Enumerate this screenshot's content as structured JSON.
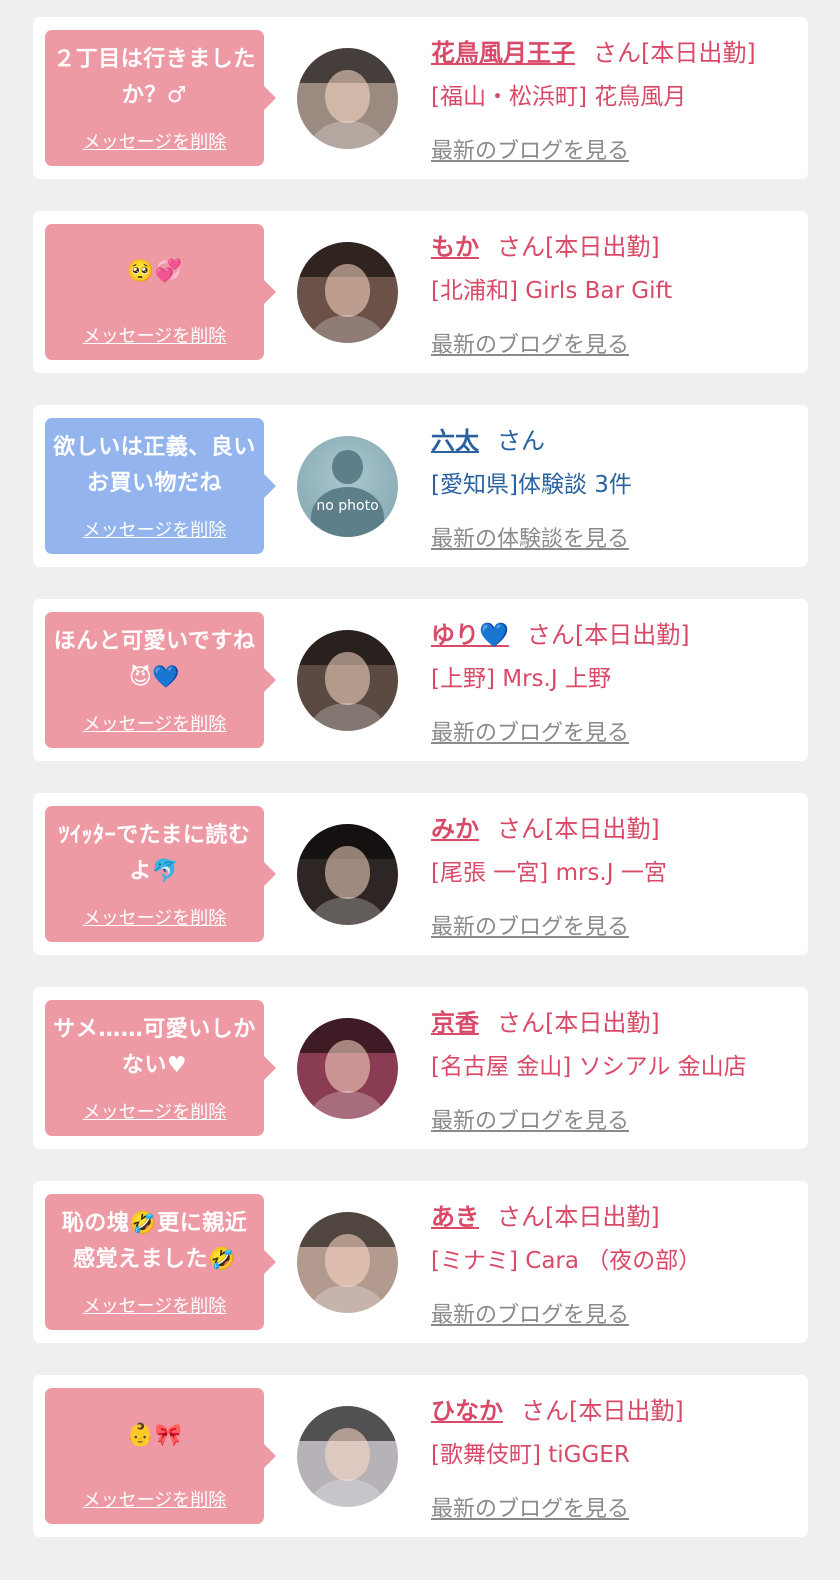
{
  "colors": {
    "background": "#efeff1",
    "card": "#ffffff",
    "bubble_pink": "#ee9aa5",
    "bubble_blue": "#93b4ec",
    "name_pink": "#d84a67",
    "name_blue": "#2a62a0",
    "link_gray": "#8a8a8a"
  },
  "cards": [
    {
      "message": "２丁目は行きましたか？♂",
      "delete_label": "メッセージを削除",
      "avatar": "face-photo",
      "avatar_color": "#9a8a80",
      "name": "花鳥風月王子",
      "suffix": "さん[本日出勤]",
      "shop": "[福山・松浜町] 花鳥風月",
      "link": "最新のブログを見る",
      "gender": "female"
    },
    {
      "message": "🥺💞",
      "delete_label": "メッセージを削除",
      "avatar": "face-photo",
      "avatar_color": "#6b5148",
      "name": "もか",
      "suffix": "さん[本日出勤]",
      "shop": "[北浦和] Girls Bar Gift",
      "link": "最新のブログを見る",
      "gender": "female"
    },
    {
      "message": "欲しいは正義、良いお買い物だね",
      "delete_label": "メッセージを削除",
      "avatar": "no-photo",
      "avatar_color": "#8fb0b9",
      "avatar_text": "no photo",
      "name": "六太",
      "suffix": "さん",
      "shop": "[愛知県]体験談 3件",
      "link": "最新の体験談を見る",
      "gender": "male"
    },
    {
      "message": "ほんと可愛いですね😈💙",
      "delete_label": "メッセージを削除",
      "avatar": "face-photo",
      "avatar_color": "#5a4a42",
      "name": "ゆり💙",
      "suffix": "さん[本日出勤]",
      "shop": "[上野] Mrs.J 上野",
      "link": "最新のブログを見る",
      "gender": "female"
    },
    {
      "message": "ﾂｲｯﾀｰでたまに読むよ🐬",
      "delete_label": "メッセージを削除",
      "avatar": "face-photo",
      "avatar_color": "#2e2624",
      "name": "みか",
      "suffix": "さん[本日出勤]",
      "shop": "[尾張 一宮] mrs.J 一宮",
      "link": "最新のブログを見る",
      "gender": "female"
    },
    {
      "message": "サメ……可愛いしかない♥",
      "delete_label": "メッセージを削除",
      "avatar": "face-photo",
      "avatar_color": "#8a3c52",
      "name": "京香",
      "suffix": "さん[本日出勤]",
      "shop": "[名古屋 金山] ソシアル 金山店",
      "link": "最新のブログを見る",
      "gender": "female"
    },
    {
      "message": "恥の塊🤣更に親近感覚えました🤣",
      "delete_label": "メッセージを削除",
      "avatar": "face-photo",
      "avatar_color": "#b39a8f",
      "name": "あき",
      "suffix": "さん[本日出勤]",
      "shop": "[ミナミ] Cara （夜の部）",
      "link": "最新のブログを見る",
      "gender": "female"
    },
    {
      "message": "👶🎀",
      "delete_label": "メッセージを削除",
      "avatar": "face-photo",
      "avatar_color": "#b6b2b8",
      "name": "ひなか",
      "suffix": "さん[本日出勤]",
      "shop": "[歌舞伎町] tiGGER",
      "link": "最新のブログを見る",
      "gender": "female"
    }
  ]
}
